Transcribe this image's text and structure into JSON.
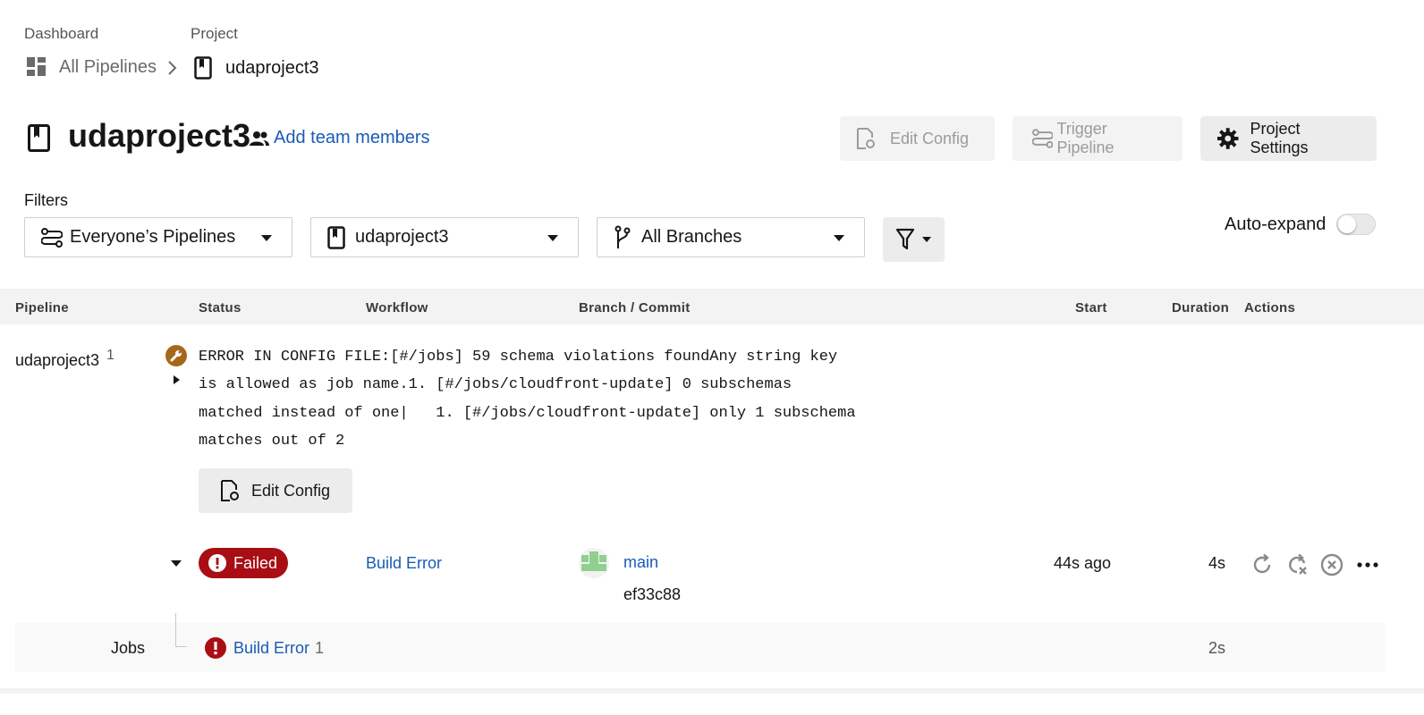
{
  "breadcrumb": {
    "dashboard_label": "Dashboard",
    "project_label": "Project",
    "all_pipelines": "All Pipelines",
    "project_name": "udaproject3"
  },
  "header": {
    "title": "udaproject3",
    "add_team_members": "Add team members",
    "edit_config": "Edit Config",
    "trigger_pipeline": "Trigger Pipeline",
    "project_settings": "Project Settings"
  },
  "filters": {
    "label": "Filters",
    "pipelines": "Everyone’s Pipelines",
    "project": "udaproject3",
    "branches": "All Branches",
    "auto_expand": "Auto-expand"
  },
  "table": {
    "headers": [
      "Pipeline",
      "Status",
      "Workflow",
      "Branch / Commit",
      "Start",
      "Duration",
      "Actions"
    ]
  },
  "pipeline": {
    "name": "udaproject3",
    "number": "1",
    "error_lines": [
      "ERROR IN CONFIG FILE:[#/jobs] 59 schema violations foundAny string key",
      "is allowed as job name.1. [#/jobs/cloudfront-update] 0 subschemas",
      "matched instead of one|   1. [#/jobs/cloudfront-update] only 1 subschema",
      "matches out of 2"
    ],
    "edit_config": "Edit Config",
    "status": "Failed",
    "workflow": "Build Error",
    "branch": "main",
    "commit": "ef33c88",
    "start": "44s ago",
    "duration": "4s"
  },
  "jobs": {
    "label": "Jobs",
    "job_name": "Build Error",
    "job_number": "1",
    "job_duration": "2s"
  },
  "colors": {
    "failed": "#a80e14",
    "link": "#1a5bb5",
    "config_error": "#a5681a"
  }
}
